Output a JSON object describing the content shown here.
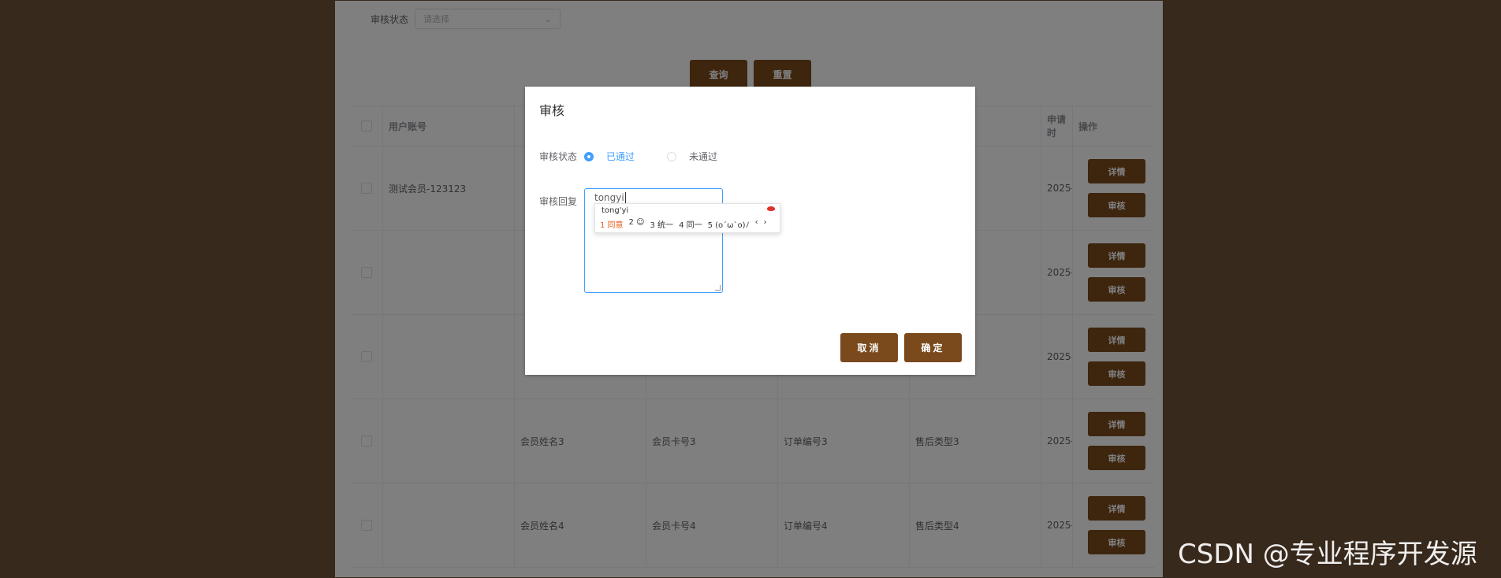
{
  "filter": {
    "label": "审核状态",
    "placeholder": "请选择"
  },
  "buttons": {
    "query": "查询",
    "reset": "重置"
  },
  "table": {
    "headers": {
      "account": "用户账号",
      "apply_date": "申请时",
      "actions": "操作"
    },
    "rows": [
      {
        "account": "测试会员-123123",
        "name": "",
        "card": "",
        "order": "",
        "type": "",
        "date": "2025-"
      },
      {
        "account": "",
        "name": "",
        "card": "",
        "order": "",
        "type": "",
        "date": "2025-"
      },
      {
        "account": "",
        "name": "",
        "card": "",
        "order": "",
        "type": "",
        "date": "2025-"
      },
      {
        "account": "",
        "name": "会员姓名3",
        "card": "会员卡号3",
        "order": "订单编号3",
        "type": "售后类型3",
        "date": "2025-"
      },
      {
        "account": "",
        "name": "会员姓名4",
        "card": "会员卡号4",
        "order": "订单编号4",
        "type": "售后类型4",
        "date": "2025-"
      }
    ],
    "action_labels": {
      "detail": "详情",
      "review": "审核"
    }
  },
  "dialog": {
    "title": "审核",
    "status_label": "审核状态",
    "options": [
      "已通过",
      "未通过"
    ],
    "selected": "已通过",
    "reply_label": "审核回复",
    "reply_value": "tongyi",
    "cancel": "取消",
    "confirm": "确定"
  },
  "ime": {
    "pinyin": "tong'yi",
    "candidates": [
      "1 同意",
      "2 ☺",
      "3 统一",
      "4 同一",
      "5 (o´ω`o)ﾉ"
    ],
    "prev": "‹",
    "next": "›"
  },
  "watermark": "CSDN @专业程序开发源"
}
